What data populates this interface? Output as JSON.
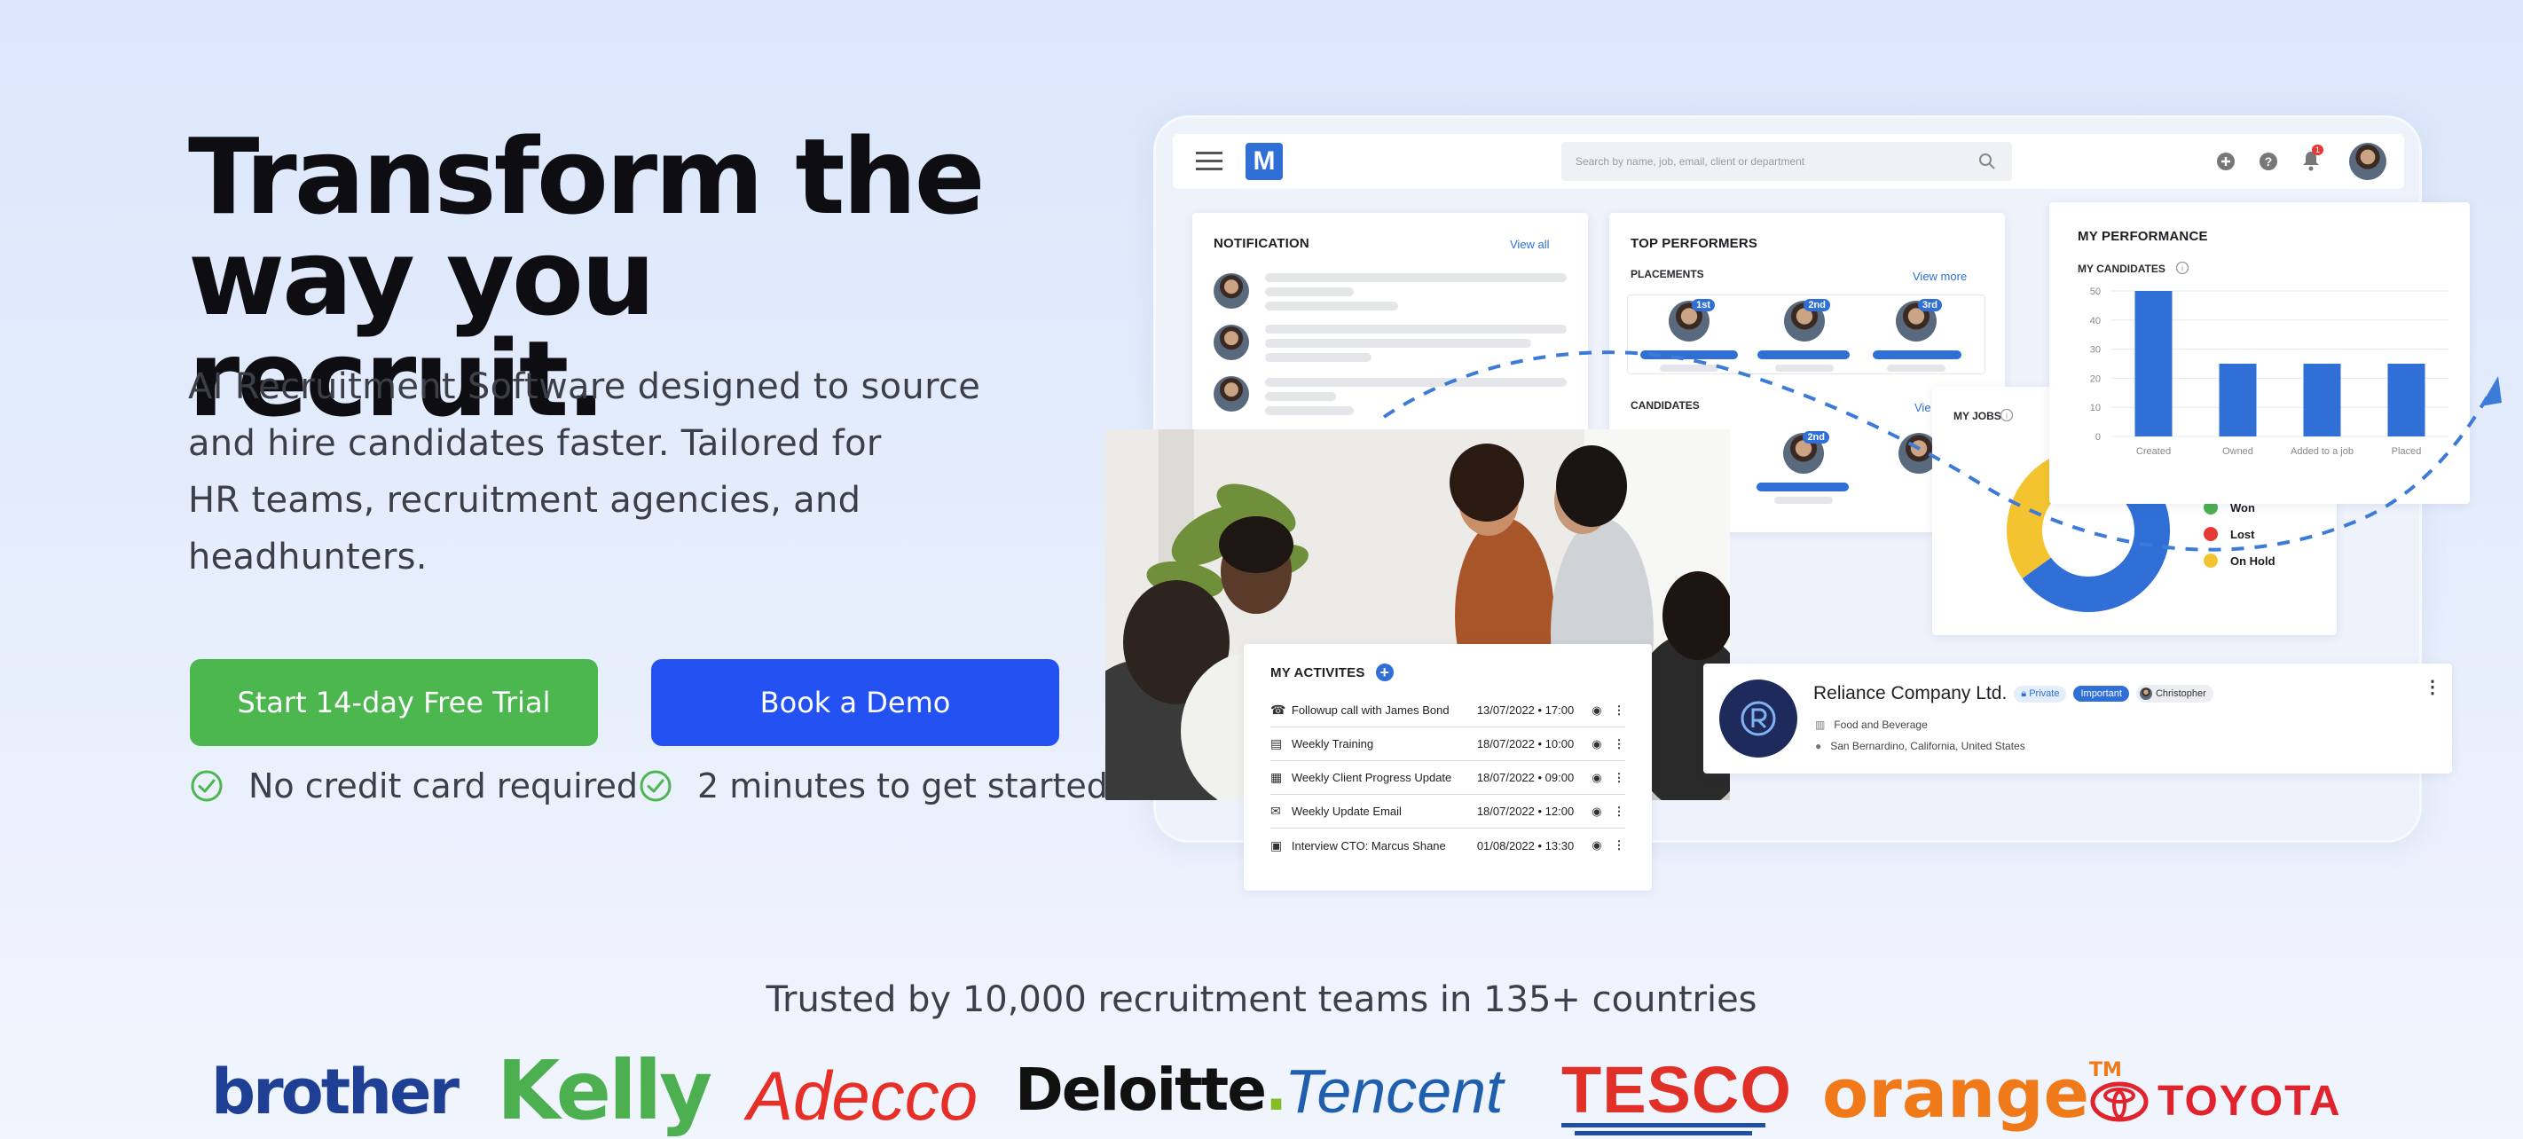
{
  "hero": {
    "title_line1": "Transform the",
    "title_line2": "way you recruit.",
    "subtitle_lines": [
      "AI Recruitment Software designed to source",
      "and hire candidates faster. Tailored for",
      "HR teams, recruitment agencies, and",
      "headhunters."
    ],
    "trial_button": "Start 14-day Free Trial",
    "demo_button": "Book a Demo",
    "perks": [
      "No credit card required",
      "2 minutes to get started"
    ]
  },
  "dashboard": {
    "logo_letter": "M",
    "search_placeholder": "Search by name, job, email, client or department",
    "notification_badge": "1",
    "notification": {
      "title": "NOTIFICATION",
      "view_all": "View all"
    },
    "top_performers": {
      "title": "TOP PERFORMERS",
      "placements_label": "PLACEMENTS",
      "view_more": "View more",
      "ranks": [
        "1st",
        "2nd",
        "3rd"
      ],
      "candidates_label": "CANDIDATES",
      "candidates_view": "Vie",
      "candidates_rank": "2nd"
    },
    "my_performance": {
      "title": "MY PERFORMANCE",
      "subtitle": "MY CANDIDATES"
    },
    "my_jobs": {
      "title": "MY JOBS",
      "legend": [
        {
          "label": "Won",
          "color": "#4caf50"
        },
        {
          "label": "Lost",
          "color": "#e53935"
        },
        {
          "label": "On Hold",
          "color": "#f4c430"
        }
      ]
    },
    "activities": {
      "title": "MY ACTIVITES",
      "rows": [
        {
          "icon": "phone-icon",
          "name": "Followup call with James Bond",
          "date": "13/07/2022 • 17:00"
        },
        {
          "icon": "document-icon",
          "name": "Weekly Training",
          "date": "18/07/2022 • 10:00"
        },
        {
          "icon": "checklist-icon",
          "name": "Weekly Client Progress Update",
          "date": "18/07/2022 • 09:00"
        },
        {
          "icon": "email-icon",
          "name": "Weekly Update Email",
          "date": "18/07/2022 • 12:00"
        },
        {
          "icon": "contact-icon",
          "name": "Interview CTO: Marcus Shane",
          "date": "01/08/2022 • 13:30"
        }
      ]
    },
    "company": {
      "name": "Reliance Company Ltd.",
      "tag_private": "Private",
      "tag_important": "Important",
      "owner": "Christopher",
      "industry": "Food and Beverage",
      "location": "San Bernardino, California, United States"
    }
  },
  "chart_data": {
    "type": "bar",
    "categories": [
      "Created",
      "Owned",
      "Added to a job",
      "Placed"
    ],
    "values": [
      50,
      25,
      25,
      25
    ],
    "ylim": [
      0,
      50
    ],
    "yticks": [
      0,
      10,
      20,
      30,
      40,
      50
    ],
    "color": "#2f6fd6"
  },
  "donut_data": {
    "type": "pie",
    "segments": [
      {
        "label": "Won",
        "value": 10,
        "color": "#4caf50"
      },
      {
        "label": "Lost",
        "value": 60,
        "color": "#2f6fd6"
      },
      {
        "label": "On Hold",
        "value": 30,
        "color": "#f4c430"
      }
    ]
  },
  "trusted": {
    "heading": "Trusted by 10,000 recruitment teams in 135+ countries",
    "logos": [
      {
        "name": "brother",
        "color": "#1f3f95"
      },
      {
        "name": "Kelly",
        "color": "#4caf50"
      },
      {
        "name": "Adecco",
        "color": "#e63027"
      },
      {
        "name": "Deloitte",
        "color": "#111111"
      },
      {
        "name": "Tencent",
        "color": "#1f5fae"
      },
      {
        "name": "TESCO",
        "color": "#e03027"
      },
      {
        "name": "orange",
        "color": "#f07a1a"
      },
      {
        "name": "TOYOTA",
        "color": "#e0232c"
      }
    ],
    "orange_tm": "TM",
    "deloitte_dot": "."
  }
}
